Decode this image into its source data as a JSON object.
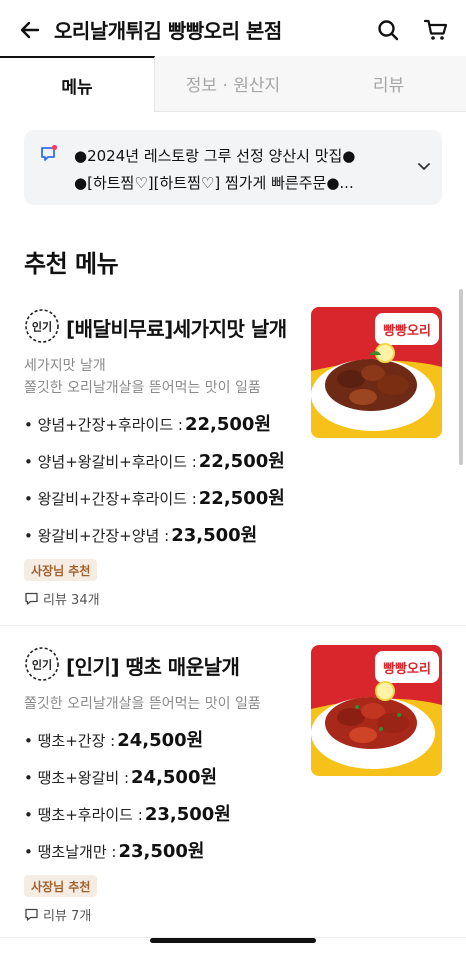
{
  "header": {
    "title": "오리날개튀김 빵빵오리 본점",
    "back_icon": "arrow-left-icon",
    "search_icon": "search-icon",
    "cart_icon": "cart-icon"
  },
  "tabs": [
    {
      "label": "메뉴",
      "active": true
    },
    {
      "label": "정보 · 원산지",
      "active": false
    },
    {
      "label": "리뷰",
      "active": false
    }
  ],
  "notice": {
    "line1": "●2024년 레스토랑 그루 선정 양산시 맛집●",
    "line2": "●[하트찜♡][하트찜♡] 찜가게 빠른주문●...",
    "icon": "megaphone-icon"
  },
  "section": {
    "title": "추천 메뉴"
  },
  "menu_items": [
    {
      "badge": "인기",
      "name": "[배달비무료]세가지맛 날개",
      "desc_lines": [
        "세가지맛 날개",
        "쫄깃한 오리날개살을 뜯어먹는 맛이 일품"
      ],
      "options": [
        {
          "label": "• 양념+간장+후라이드 :",
          "price": "22,500원"
        },
        {
          "label": "• 양념+왕갈비+후라이드 :",
          "price": "22,500원"
        },
        {
          "label": "• 왕갈비+간장+후라이드 :",
          "price": "22,500원"
        },
        {
          "label": "• 왕갈비+간장+양념 :",
          "price": "23,500원"
        }
      ],
      "owner_badge": "사장님 추천",
      "review": "리뷰 34개",
      "image_brand": "빵빵오리"
    },
    {
      "badge": "인기",
      "name": "[인기] 땡초 매운날개",
      "desc_lines": [
        "쫄깃한 오리날개살을 뜯어먹는 맛이 일품"
      ],
      "options": [
        {
          "label": "• 땡초+간장 :",
          "price": "24,500원"
        },
        {
          "label": "• 땡초+왕갈비 :",
          "price": "24,500원"
        },
        {
          "label": "• 땡초+후라이드 :",
          "price": "23,500원"
        },
        {
          "label": "• 땡초날개만 :",
          "price": "23,500원"
        }
      ],
      "owner_badge": "사장님 추천",
      "review": "리뷰 7개",
      "image_brand": "빵빵오리"
    }
  ],
  "colors": {
    "accent_badge_bg": "#f5ece3",
    "accent_badge_text": "#a0622d",
    "notice_bg": "#f3f4f6",
    "image_bg_yellow": "#f6c21a",
    "image_bg_red": "#d9262c"
  }
}
